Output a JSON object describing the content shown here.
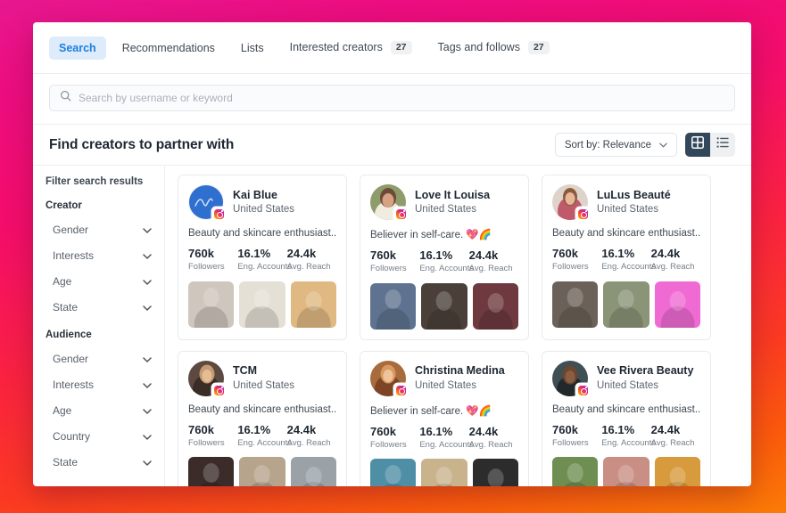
{
  "window": {
    "title": "Find creators to partner with"
  },
  "tabs": [
    {
      "label": "Search",
      "badge": null,
      "active": true
    },
    {
      "label": "Recommendations",
      "badge": null,
      "active": false
    },
    {
      "label": "Lists",
      "badge": null,
      "active": false
    },
    {
      "label": "Interested creators",
      "badge": "27",
      "active": false
    },
    {
      "label": "Tags and follows",
      "badge": "27",
      "active": false
    }
  ],
  "search": {
    "placeholder": "Search by username or keyword",
    "value": "",
    "icon": "search-icon"
  },
  "toolbar": {
    "sort_label": "Sort by: Relevance",
    "sort_caret": "chevron-down-icon",
    "grid_view_icon": "grid-view-icon",
    "list_view_icon": "list-view-icon",
    "active_view": "grid"
  },
  "sidebar": {
    "heading": "Filter search results",
    "groups": [
      {
        "label": "Creator",
        "items": [
          {
            "label": "Gender"
          },
          {
            "label": "Interests"
          },
          {
            "label": "Age"
          },
          {
            "label": "State"
          }
        ]
      },
      {
        "label": "Audience",
        "items": [
          {
            "label": "Gender"
          },
          {
            "label": "Interests"
          },
          {
            "label": "Age"
          },
          {
            "label": "Country"
          },
          {
            "label": "State"
          }
        ]
      }
    ]
  },
  "stat_labels": {
    "followers": "Followers",
    "eng_accounts": "Eng. Accounts",
    "avg_reach": "Avg. Reach"
  },
  "creators": [
    {
      "name": "Kai Blue",
      "country": "United States",
      "bio": "Beauty and skincare enthusiast...",
      "followers": "760k",
      "eng_accounts": "16.1%",
      "avg_reach": "24.4k",
      "avatar_style": "blue-script",
      "thumb_tones": [
        "#cfc6bd",
        "#e5e0d6",
        "#e0b882"
      ]
    },
    {
      "name": "Love It Louisa",
      "country": "United States",
      "bio": "Believer in self-care. 💖🌈",
      "followers": "760k",
      "eng_accounts": "16.1%",
      "avg_reach": "24.4k",
      "avatar_style": "portrait-green",
      "thumb_tones": [
        "#5f7390",
        "#4a4039",
        "#6e3a3f"
      ]
    },
    {
      "name": "LuLus Beauté",
      "country": "United States",
      "bio": "Beauty and skincare enthusiast...",
      "followers": "760k",
      "eng_accounts": "16.1%",
      "avg_reach": "24.4k",
      "avatar_style": "portrait-pink",
      "thumb_tones": [
        "#6c6158",
        "#8a9477",
        "#f06ad4"
      ]
    },
    {
      "name": "TCM",
      "country": "United States",
      "bio": "Beauty and skincare enthusiast...",
      "followers": "760k",
      "eng_accounts": "16.1%",
      "avg_reach": "24.4k",
      "avatar_style": "portrait-warm",
      "thumb_tones": [
        "#3b2c2a",
        "#b6a48c",
        "#9aa2a8"
      ]
    },
    {
      "name": "Christina Medina",
      "country": "United States",
      "bio": "Believer in self-care. 💖🌈",
      "followers": "760k",
      "eng_accounts": "16.1%",
      "avg_reach": "24.4k",
      "avatar_style": "portrait-autumn",
      "thumb_tones": [
        "#4f8fa6",
        "#c9b38d",
        "#2c2c2c"
      ]
    },
    {
      "name": "Vee Rivera Beauty",
      "country": "United States",
      "bio": "Beauty and skincare enthusiast...",
      "followers": "760k",
      "eng_accounts": "16.1%",
      "avg_reach": "24.4k",
      "avatar_style": "portrait-dark",
      "thumb_tones": [
        "#6f8f52",
        "#c98f84",
        "#d79a3c"
      ]
    }
  ],
  "colors": {
    "accent_blue": "#1b7fe0",
    "active_tab_bg": "#deebfb",
    "toggle_active": "#33475b",
    "background_top": "#e8178f",
    "background_bottom": "#fb7b06"
  }
}
